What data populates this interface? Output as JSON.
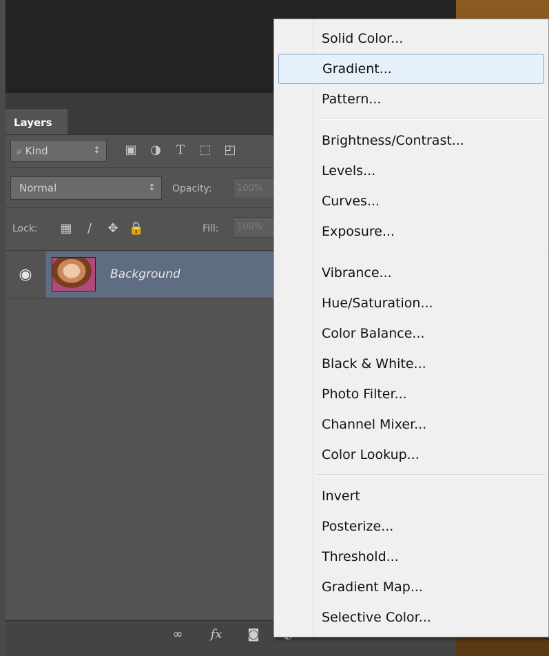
{
  "panel": {
    "tab_label": "Layers",
    "filter": {
      "select_value": "Kind",
      "icons": [
        "image-icon",
        "adjustment-icon",
        "type-icon",
        "shape-icon",
        "smart-object-icon"
      ]
    },
    "blend_mode": "Normal",
    "opacity_label": "Opacity:",
    "opacity_value": "100%",
    "lock_label": "Lock:",
    "fill_label": "Fill:",
    "fill_value": "100%",
    "layer": {
      "name": "Background",
      "visible_icon": "eye-icon",
      "selected_color": "#5e6d82"
    },
    "bottom_icons": [
      "link-icon",
      "fx-icon",
      "mask-icon",
      "adjustment-icon"
    ]
  },
  "menu": {
    "groups": [
      [
        "Solid Color...",
        "Gradient...",
        "Pattern..."
      ],
      [
        "Brightness/Contrast...",
        "Levels...",
        "Curves...",
        "Exposure..."
      ],
      [
        "Vibrance...",
        "Hue/Saturation...",
        "Color Balance...",
        "Black & White...",
        "Photo Filter...",
        "Channel Mixer...",
        "Color Lookup..."
      ],
      [
        "Invert",
        "Posterize...",
        "Threshold...",
        "Gradient Map...",
        "Selective Color..."
      ]
    ],
    "highlighted": "Gradient...",
    "highlight_color": "#e6f0fa"
  }
}
